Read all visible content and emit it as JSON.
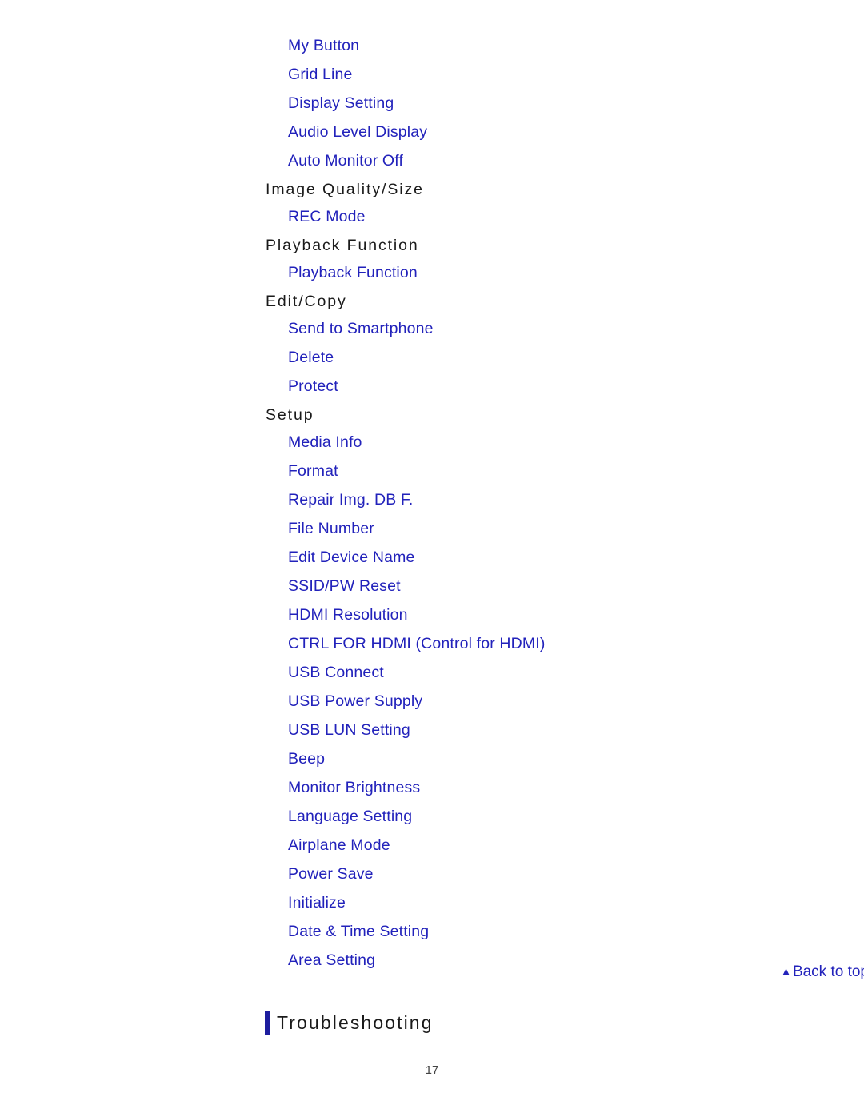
{
  "page": {
    "page_number": "17",
    "link_color": "#2222bb",
    "heading_color": "#1a1a1a",
    "accent_bar_color": "#1d1d9e",
    "background_color": "#ffffff"
  },
  "continued_list": {
    "items": [
      "My Button",
      "Grid Line",
      "Display Setting",
      "Audio Level Display",
      "Auto Monitor Off"
    ]
  },
  "sections": [
    {
      "heading": "Image Quality/Size",
      "items": [
        "REC Mode"
      ]
    },
    {
      "heading": "Playback Function",
      "items": [
        "Playback Function"
      ]
    },
    {
      "heading": "Edit/Copy",
      "items": [
        "Send to Smartphone",
        "Delete",
        "Protect"
      ]
    },
    {
      "heading": "Setup",
      "items": [
        "Media Info",
        "Format",
        "Repair Img. DB F.",
        "File Number",
        "Edit Device Name",
        "SSID/PW Reset",
        "HDMI Resolution",
        "CTRL FOR HDMI (Control for HDMI)",
        "USB Connect",
        "USB Power Supply",
        "USB LUN Setting",
        "Beep",
        "Monitor Brightness",
        "Language Setting",
        "Airplane Mode",
        "Power Save",
        "Initialize",
        "Date & Time Setting",
        "Area Setting"
      ]
    }
  ],
  "back_to_top": {
    "icon": "triangle-up-icon",
    "glyph": "▲",
    "label": "Back to top"
  },
  "chapter": {
    "title": "Troubleshooting"
  }
}
